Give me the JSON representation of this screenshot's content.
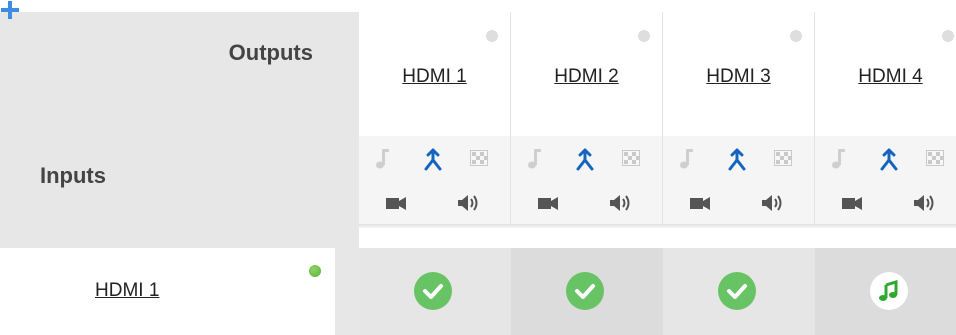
{
  "header": {
    "outputs_label": "Outputs",
    "inputs_label": "Inputs"
  },
  "outputs": [
    {
      "name": "HDMI 1",
      "status": "inactive"
    },
    {
      "name": "HDMI 2",
      "status": "inactive"
    },
    {
      "name": "HDMI 3",
      "status": "inactive"
    },
    {
      "name": "HDMI 4",
      "status": "inactive"
    }
  ],
  "output_tools": [
    "music-note-icon",
    "merge-routing-icon",
    "pattern-grid-icon",
    "video-camera-icon",
    "speaker-icon"
  ],
  "inputs": [
    {
      "name": "HDMI 1",
      "status": "active",
      "routes": [
        "check",
        "check",
        "check",
        "audio"
      ]
    }
  ],
  "colors": {
    "active_green": "#58b133",
    "check_green": "#67c364",
    "routing_blue": "#1565c0",
    "panel_gray": "#e7e7e7",
    "plus_blue": "#3b8ee0"
  }
}
